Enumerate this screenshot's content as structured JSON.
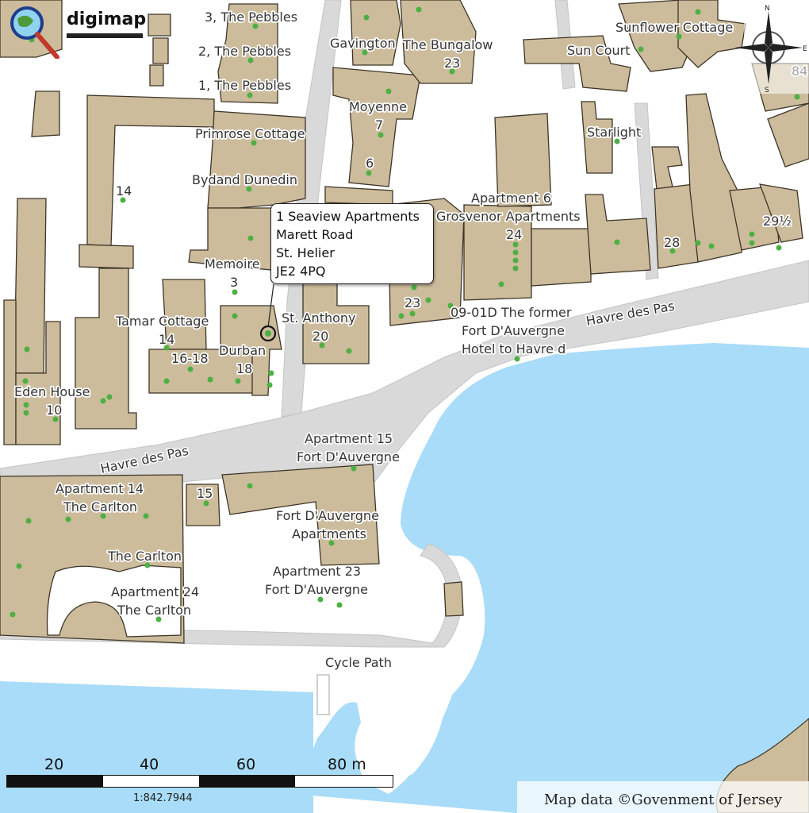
{
  "app": {
    "logo_text": "digimap"
  },
  "colors": {
    "water": "#a9dcf8",
    "building": "#cdbc9c",
    "building_outline": "#3c3426",
    "road": "#d9d9d9",
    "tree": "#4cb043",
    "land": "#ffffff"
  },
  "labels": {
    "pebbles3": "3, The Pebbles",
    "pebbles2": "2, The Pebbles",
    "pebbles1": "1, The Pebbles",
    "gavington": "Gavington",
    "bungalow": "The Bungalow",
    "bungalow_num": "23",
    "sunflower": "Sunflower Cottage",
    "suncourt": "Sun Court",
    "moyenne": "Moyenne",
    "moyenne_num": "7",
    "starlight": "Starlight",
    "primrose": "Primrose Cottage",
    "num14a": "14",
    "bydand": "Bydand Dunedin",
    "num6": "6",
    "apt6": "Apartment 6",
    "grosvenor": "Grosvenor Apartments",
    "num24": "24",
    "num28": "28",
    "num29": "29½",
    "memoire": "Memoire",
    "memoire_num": "3",
    "num23": "23",
    "fa1": "09-01D The former",
    "fa2": "Fort D'Auvergne",
    "fa3": "Hotel to Havre d",
    "tamar": "Tamar Cottage",
    "tamar_num": "14",
    "anthony": "St. Anthony",
    "anthony_num": "20",
    "n1618": "16-18",
    "durban": "Durban",
    "durban_num": "18",
    "eden": "Eden House",
    "eden_num": "10",
    "apt15": "Apartment 15",
    "apt15b": "Fort D'Auvergne",
    "apt14": "Apartment 14",
    "apt14b": "The Carlton",
    "num15": "15",
    "fda_apts1": "Fort D'Auvergne",
    "fda_apts2": "Apartments",
    "carlton": "The Carlton",
    "apt23": "Apartment 23",
    "apt23b": "Fort D'Auvergne",
    "apt24": "Apartment 24",
    "apt24b": "The Carlton",
    "num84": "84"
  },
  "roads": {
    "havre1": "Havre des Pas",
    "havre2": "Havre des Pas",
    "cycle": "Cycle Path"
  },
  "popup": {
    "line1": "1 Seaview Apartments",
    "line2": "Marett Road",
    "line3": "St. Helier",
    "line4": "JE2 4PQ"
  },
  "scale": {
    "t20": "20",
    "t40": "40",
    "t60": "60",
    "t80": "80 m",
    "ratio": "1:842.7944"
  },
  "compass": {
    "n": "N",
    "s": "S",
    "e": "E",
    "w": "W"
  },
  "attribution": "Map data ©Govenment of Jersey"
}
